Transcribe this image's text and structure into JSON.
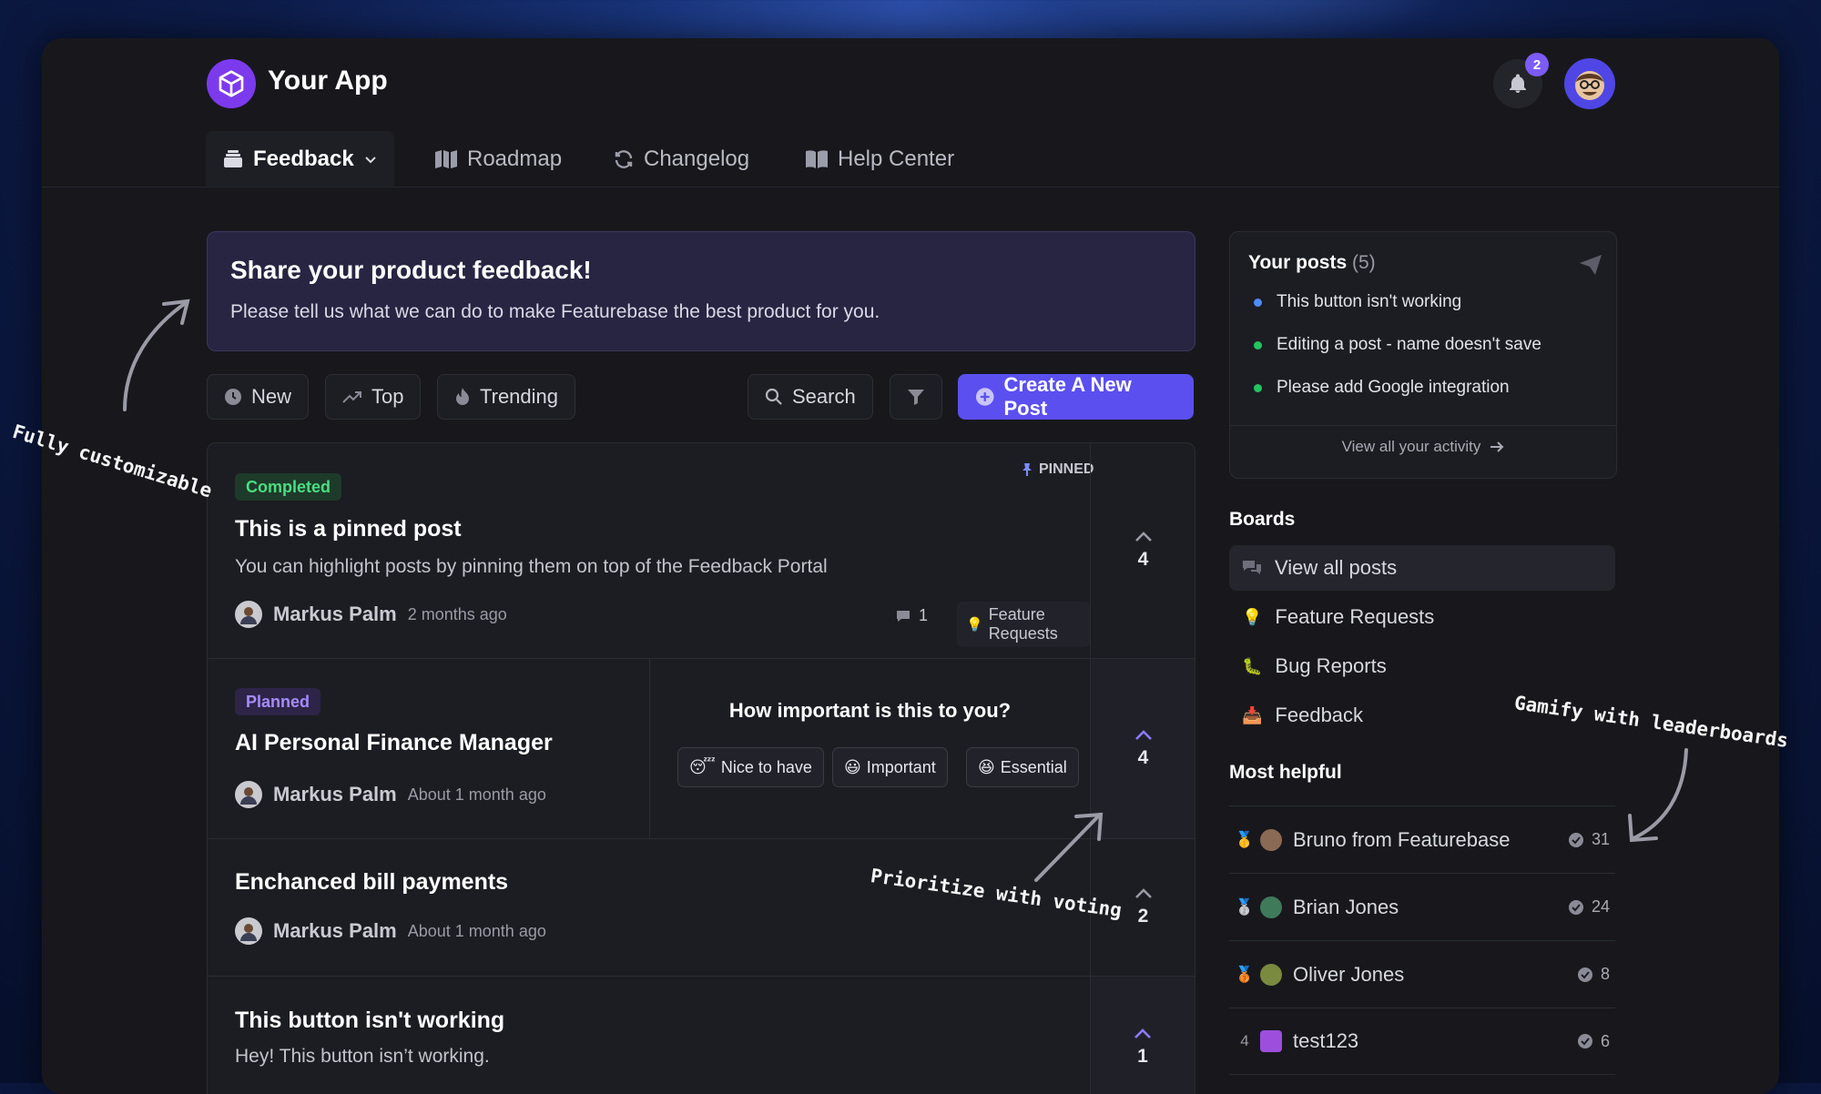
{
  "app": {
    "name": "Your App",
    "notification_count": "2"
  },
  "nav": {
    "items": [
      {
        "label": "Feedback",
        "icon": "inbox-icon"
      },
      {
        "label": "Roadmap",
        "icon": "map-icon"
      },
      {
        "label": "Changelog",
        "icon": "refresh-icon"
      },
      {
        "label": "Help Center",
        "icon": "book-icon"
      }
    ]
  },
  "banner": {
    "title": "Share your product feedback!",
    "subtitle": "Please tell us what we can do to make Featurebase the best product for you."
  },
  "toolbar": {
    "new": "New",
    "top": "Top",
    "trending": "Trending",
    "search": "Search",
    "create": "Create A New Post"
  },
  "posts": [
    {
      "status": "Completed",
      "pinned_label": "PINNED",
      "title": "This is a pinned post",
      "description": "You can highlight posts by pinning them on top of the Feedback Portal",
      "author": "Markus Palm",
      "time": "2 months ago",
      "comments": "1",
      "board": "Feature Requests",
      "votes": "4"
    },
    {
      "status": "Planned",
      "title": "AI Personal Finance Manager",
      "author": "Markus Palm",
      "time": "About 1 month ago",
      "votes": "4",
      "poll": {
        "question": "How important is this to you?",
        "options": [
          "Nice to have",
          "Important",
          "Essential"
        ]
      }
    },
    {
      "title": "Enchanced bill payments",
      "author": "Markus Palm",
      "time": "About 1 month ago",
      "votes": "2"
    },
    {
      "title": "This button isn't working",
      "description": "Hey! This button isn’t working.",
      "votes": "1"
    }
  ],
  "your_posts": {
    "title": "Your posts",
    "count": "(5)",
    "items": [
      {
        "text": "This button isn't working",
        "color": "#4f8cff"
      },
      {
        "text": "Editing a post - name doesn't save",
        "color": "#22c55e"
      },
      {
        "text": "Please add Google integration",
        "color": "#22c55e"
      }
    ],
    "view_all": "View all your activity"
  },
  "boards": {
    "title": "Boards",
    "items": [
      {
        "label": "View all posts",
        "icon": "chat-bubbles-icon"
      },
      {
        "label": "Feature Requests",
        "icon": "lightbulb-icon"
      },
      {
        "label": "Bug Reports",
        "icon": "bug-icon"
      },
      {
        "label": "Feedback",
        "icon": "inbox-tray-icon"
      }
    ]
  },
  "most_helpful": {
    "title": "Most helpful",
    "items": [
      {
        "rank": "",
        "name": "Bruno from Featurebase",
        "score": "31"
      },
      {
        "rank": "",
        "name": "Brian Jones",
        "score": "24"
      },
      {
        "rank": "",
        "name": "Oliver Jones",
        "score": "8"
      },
      {
        "rank": "4",
        "name": "test123",
        "score": "6"
      }
    ]
  },
  "annotations": {
    "customizable": "Fully customizable",
    "voting": "Prioritize with voting",
    "leaderboards": "Gamify with leaderboards"
  },
  "colors": {
    "accent": "#5b4ff0",
    "completed": "#22c55e",
    "planned": "#a78bfa"
  }
}
